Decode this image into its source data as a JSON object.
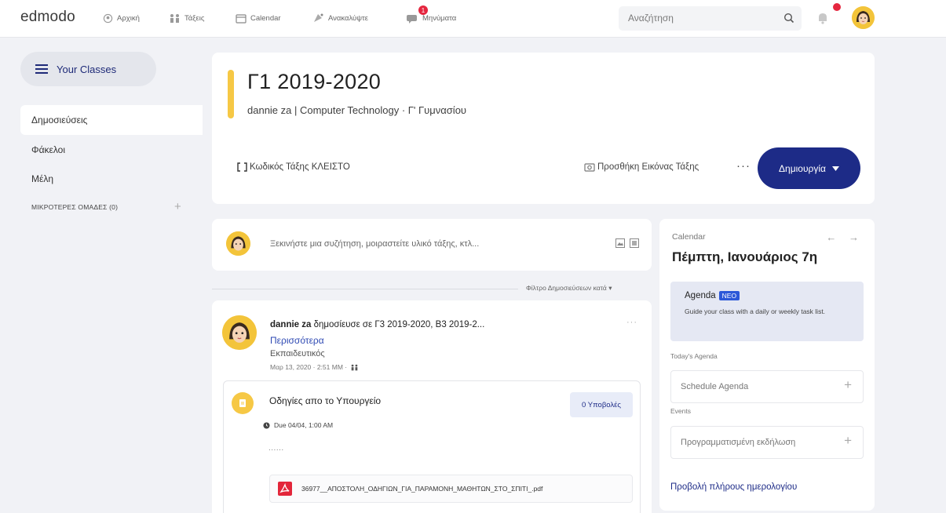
{
  "app": {
    "logo": "edmodo"
  },
  "nav": {
    "home": "Αρχική",
    "classes": "Τάξεις",
    "calendar": "Calendar",
    "discover": "Ανακαλύψτε",
    "messages": "Μηνύματα"
  },
  "search": {
    "placeholder": "Αναζήτηση"
  },
  "sidebar": {
    "your_classes": "Your Classes",
    "items": [
      "Δημοσιεύσεις",
      "Φάκελοι",
      "Μέλη"
    ],
    "small_groups": "ΜΙΚΡΟΤΕΡΕΣ ΟΜΑΔΕΣ (0)"
  },
  "header": {
    "title": "Γ1 2019-2020",
    "subtitle": "dannie za | Computer Technology  · Γ' Γυμνασίου",
    "class_code": "Κωδικός Τάξης ΚΛΕΙΣΤΟ",
    "add_image": "Προσθήκη Εικόνας Τάξης",
    "more": "···",
    "create": "Δημιουργία"
  },
  "composer": {
    "placeholder": "Ξεκινήστε μια συζήτηση, μοιραστείτε υλικό τάξης, κτλ..."
  },
  "filter": {
    "label": "Φίλτρο Δημοσιεύσεων κατά"
  },
  "post": {
    "author": "dannie za",
    "action": "δημοσίευσε σε Γ3 2019-2020,  Β3 2019-2...",
    "more": "Περισσότερα",
    "role": "Εκπαιδευτικός",
    "time": "Μαρ 13, 2020 · 2:51 ΜΜ ·",
    "dots": "···"
  },
  "assignment": {
    "title": "Οδηγίες απο το Υπουργείο",
    "submissions": "0 Υποβολές",
    "due": "Due 04/04, 1:00 AM",
    "body": "......",
    "file": "36977__ΑΠΟΣΤΟΛΗ_ΟΔΗΓΙΩΝ_ΓΙΑ_ΠΑΡΑΜΟΝΗ_ΜΑΘΗΤΩΝ_ΣΤΟ_ΣΠΙΤΙ_.pdf"
  },
  "calendar": {
    "label": "Calendar",
    "arrows": "← →",
    "date": "Πέμπτη, Ιανουάριος 7η",
    "agenda_title": "Agenda",
    "agenda_badge": "ΝΕΟ",
    "agenda_desc": "Guide your class with a daily or weekly task list.",
    "todays_agenda": "Today's Agenda",
    "schedule_agenda": "Schedule Agenda",
    "events": "Events",
    "scheduled_event": "Προγραμματισμένη εκδήλωση",
    "full_calendar": "Προβολή πλήρους ημερολογίου"
  },
  "badges": {
    "messages_count": "1"
  },
  "colors": {
    "accent": "#1d2b87",
    "yellow": "#f6c845",
    "badge": "#e5263f"
  }
}
